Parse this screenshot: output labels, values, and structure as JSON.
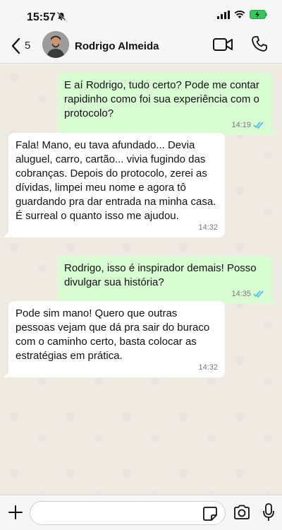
{
  "status_bar": {
    "time": "15:57"
  },
  "header": {
    "back_count": "5",
    "contact_name": "Rodrigo Almeida"
  },
  "messages": [
    {
      "direction": "out",
      "text": "E aí Rodrigo, tudo certo? Pode me contar rapidinho como foi sua experiência com o protocolo?",
      "time": "14:19",
      "read": true
    },
    {
      "direction": "in",
      "text": "Fala! Mano, eu tava afundado... Devia aluguel, carro, cartão... vivia fugindo das cobranças. Depois do protocolo, zerei as dívidas, limpei meu nome e agora tô guardando pra dar entrada na minha casa. É surreal o quanto isso me ajudou.",
      "time": "14:32"
    },
    {
      "direction": "out",
      "text": "Rodrigo, isso é inspirador demais! Posso divulgar sua história?",
      "time": "14:35",
      "read": true
    },
    {
      "direction": "in",
      "text": "Pode sim mano! Quero que outras pessoas vejam que dá pra sair do buraco com o caminho certo, basta colocar as estratégias em prática.",
      "time": "14:32"
    }
  ],
  "composer": {
    "placeholder": ""
  },
  "colors": {
    "outgoing_bubble": "#d9fdd3",
    "incoming_bubble": "#ffffff",
    "read_ticks": "#34b7f1",
    "chat_background": "#efeae2"
  }
}
